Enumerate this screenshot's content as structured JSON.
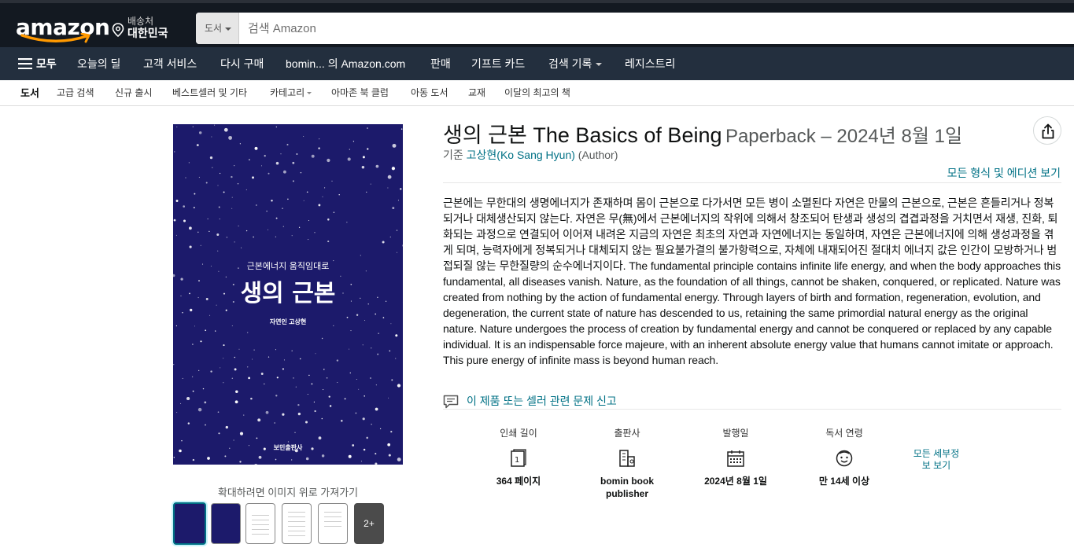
{
  "header": {
    "logo": "amazon",
    "deliver_line1": "배송처",
    "deliver_line2": "대한민국",
    "search_category": "도서",
    "search_placeholder": "검색 Amazon"
  },
  "nav": {
    "all": "모두",
    "items": [
      "오늘의 딜",
      "고객 서비스",
      "다시 구매",
      "bomin... 의 Amazon.com",
      "판매",
      "기프트 카드",
      "검색 기록",
      "레지스트리"
    ]
  },
  "subnav": {
    "items": [
      "도서",
      "고급 검색",
      "신규 출시",
      "베스트셀러 및 기타",
      "카테고리",
      "아마존 북 클럽",
      "아동 도서",
      "교재",
      "이달의 최고의 책"
    ]
  },
  "cover": {
    "subtitle": "근본에너지 움직임대로",
    "title": "생의 근본",
    "author": "자연인 고상현",
    "publisher": "보민출판사"
  },
  "gallery": {
    "hint": "확대하려면 이미지 위로 가져가기",
    "more_label": "2+"
  },
  "product": {
    "title": "생의 근본 The Basics of Being",
    "format": "Paperback – 2024년 8월 1일",
    "by_prefix": "기준",
    "author": "고상현(Ko Sang Hyun)",
    "author_role": "(Author)",
    "all_formats": "모든 형식 및 에디션 보기",
    "description": "근본에는 무한대의 생명에너지가 존재하며 몸이 근본으로 다가서면 모든 병이 소멸된다 자연은 만물의 근본으로, 근본은 흔들리거나 정복되거나 대체생산되지 않는다. 자연은 무(無)에서 근본에너지의 작위에 의해서 창조되어 탄생과 생성의 겹겹과정을 거치면서 재생, 진화, 퇴화되는 과정으로 연결되어 이어져 내려온 지금의 자연은 최초의 자연과 자연에너지는 동일하며, 자연은 근본에너지에 의해 생성과정을 겪게 되며, 능력자에게 정복되거나 대체되지 않는 필요불가결의 불가항력으로, 자체에 내재되어진 절대치 에너지 값은 인간이 모방하거나 범접되질 않는 무한질량의 순수에너지이다. The fundamental principle contains infinite life energy, and when the body approaches this fundamental, all diseases vanish. Nature, as the foundation of all things, cannot be shaken, conquered, or replicated. Nature was created from nothing by the action of fundamental energy. Through layers of birth and formation, regeneration, evolution, and degeneration, the current state of nature has descended to us, retaining the same primordial natural energy as the original nature. Nature undergoes the process of creation by fundamental energy and cannot be conquered or replaced by any capable individual. It is an indispensable force majeure, with an inherent absolute energy value that humans cannot imitate or approach. This pure energy of infinite mass is beyond human reach.",
    "report": "이 제품 또는 셀러 관련 문제 신고"
  },
  "details": {
    "pages_label": "인쇄 길이",
    "pages_value": "364 페이지",
    "publisher_label": "출판사",
    "publisher_value_1": "bomin book",
    "publisher_value_2": "publisher",
    "date_label": "발행일",
    "date_value": "2024년 8월 1일",
    "age_label": "독서 연령",
    "age_value": "만 14세 이상",
    "more_1": "모든 세부정",
    "more_2": "보 보기"
  }
}
